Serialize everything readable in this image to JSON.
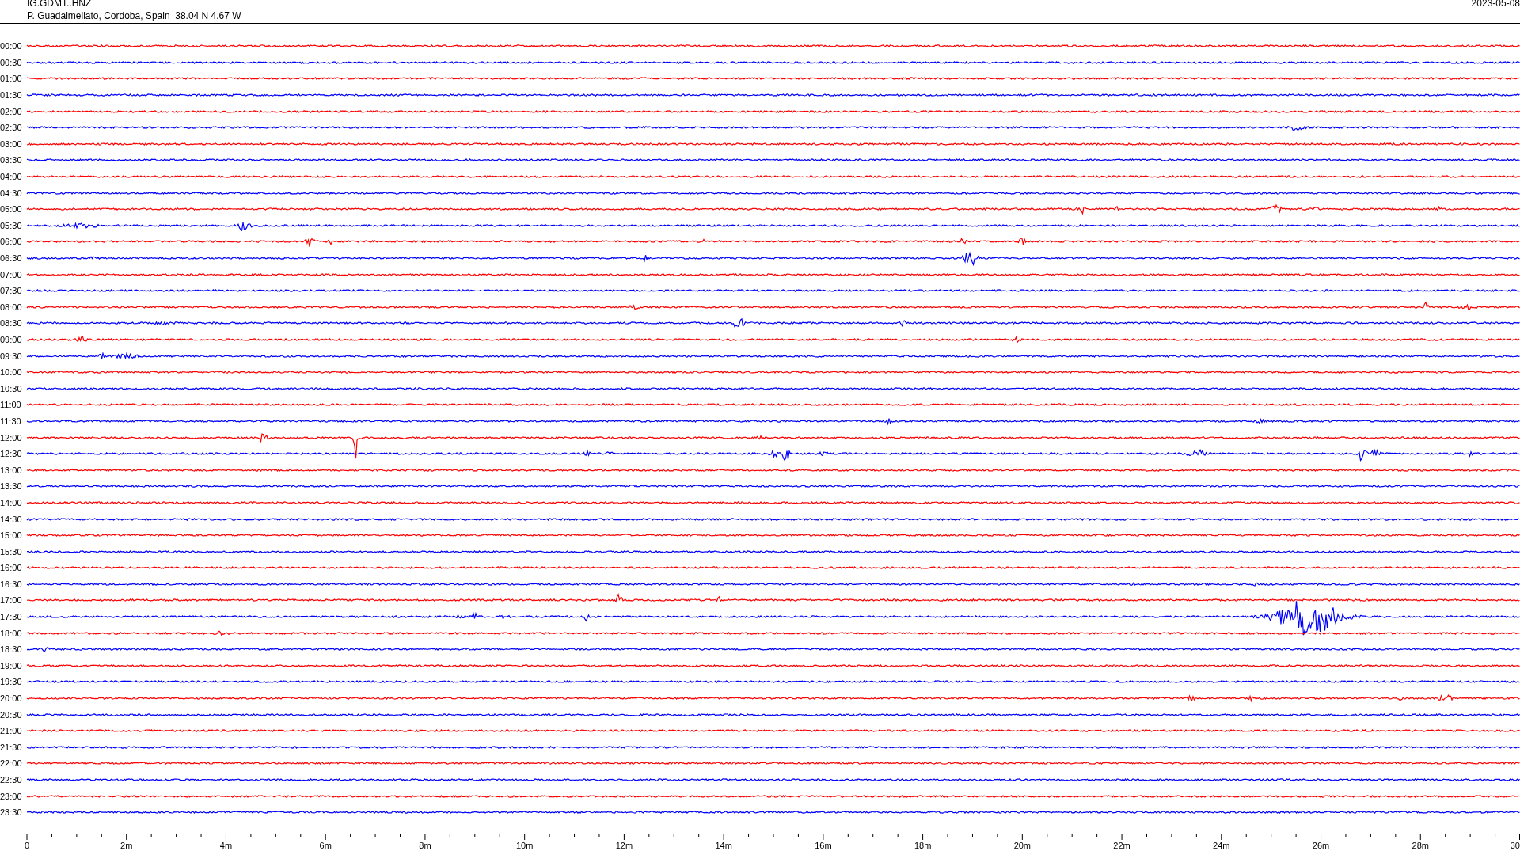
{
  "header": {
    "station": "IG.GDMT..HNZ",
    "location": "P. Guadalmellato, Cordoba, Spain  38.04 N 4.67 W",
    "date": "2023-05-08"
  },
  "rows": [
    {
      "time": "00:00",
      "color": "#ff0000"
    },
    {
      "time": "00:30",
      "color": "#0000ff"
    },
    {
      "time": "01:00",
      "color": "#ff0000"
    },
    {
      "time": "01:30",
      "color": "#0000ff"
    },
    {
      "time": "02:00",
      "color": "#ff0000"
    },
    {
      "time": "02:30",
      "color": "#0000ff"
    },
    {
      "time": "03:00",
      "color": "#ff0000"
    },
    {
      "time": "03:30",
      "color": "#0000ff"
    },
    {
      "time": "04:00",
      "color": "#ff0000"
    },
    {
      "time": "04:30",
      "color": "#0000ff"
    },
    {
      "time": "05:00",
      "color": "#ff0000"
    },
    {
      "time": "05:30",
      "color": "#0000ff"
    },
    {
      "time": "06:00",
      "color": "#ff0000"
    },
    {
      "time": "06:30",
      "color": "#0000ff"
    },
    {
      "time": "07:00",
      "color": "#ff0000"
    },
    {
      "time": "07:30",
      "color": "#0000ff"
    },
    {
      "time": "08:00",
      "color": "#ff0000"
    },
    {
      "time": "08:30",
      "color": "#0000ff"
    },
    {
      "time": "09:00",
      "color": "#ff0000"
    },
    {
      "time": "09:30",
      "color": "#0000ff"
    },
    {
      "time": "10:00",
      "color": "#ff0000"
    },
    {
      "time": "10:30",
      "color": "#0000ff"
    },
    {
      "time": "11:00",
      "color": "#ff0000"
    },
    {
      "time": "11:30",
      "color": "#0000ff"
    },
    {
      "time": "12:00",
      "color": "#ff0000"
    },
    {
      "time": "12:30",
      "color": "#0000ff"
    },
    {
      "time": "13:00",
      "color": "#ff0000"
    },
    {
      "time": "13:30",
      "color": "#0000ff"
    },
    {
      "time": "14:00",
      "color": "#ff0000"
    },
    {
      "time": "14:30",
      "color": "#0000ff"
    },
    {
      "time": "15:00",
      "color": "#ff0000"
    },
    {
      "time": "15:30",
      "color": "#0000ff"
    },
    {
      "time": "16:00",
      "color": "#ff0000"
    },
    {
      "time": "16:30",
      "color": "#0000ff"
    },
    {
      "time": "17:00",
      "color": "#ff0000"
    },
    {
      "time": "17:30",
      "color": "#0000ff"
    },
    {
      "time": "18:00",
      "color": "#ff0000"
    },
    {
      "time": "18:30",
      "color": "#0000ff"
    },
    {
      "time": "19:00",
      "color": "#ff0000"
    },
    {
      "time": "19:30",
      "color": "#0000ff"
    },
    {
      "time": "20:00",
      "color": "#ff0000"
    },
    {
      "time": "20:30",
      "color": "#0000ff"
    },
    {
      "time": "21:00",
      "color": "#ff0000"
    },
    {
      "time": "21:30",
      "color": "#0000ff"
    },
    {
      "time": "22:00",
      "color": "#ff0000"
    },
    {
      "time": "22:30",
      "color": "#0000ff"
    },
    {
      "time": "23:00",
      "color": "#ff0000"
    },
    {
      "time": "23:30",
      "color": "#0000ff"
    }
  ],
  "x_axis": {
    "labels": [
      "0",
      "2m",
      "4m",
      "6m",
      "8m",
      "10m",
      "12m",
      "14m",
      "16m",
      "18m",
      "20m",
      "22m",
      "24m",
      "26m",
      "28m",
      "30"
    ]
  }
}
